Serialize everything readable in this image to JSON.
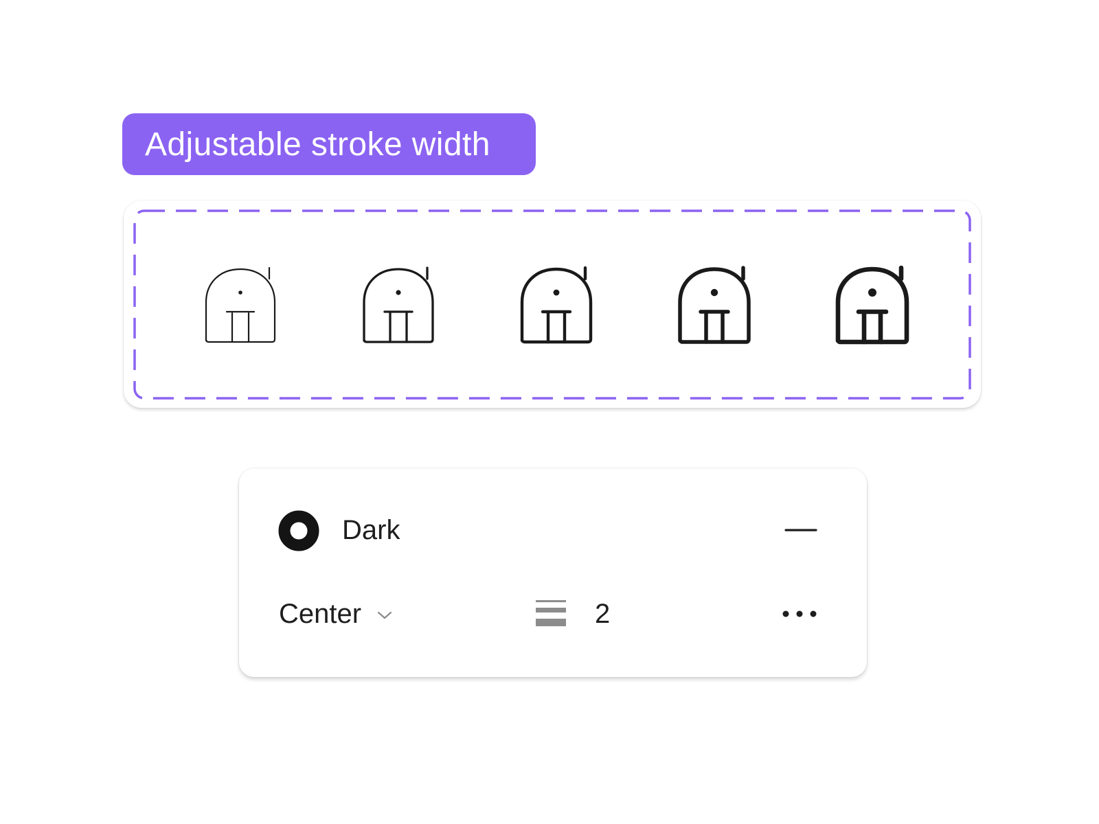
{
  "badge": {
    "label": "Adjustable stroke width",
    "color": "#8b63f2"
  },
  "showcase": {
    "frame_color": "#8b63f2",
    "icon_name": "android-icon",
    "icon_color": "#1a1a1a",
    "stroke_variants": [
      1,
      1.5,
      2,
      2.5,
      3
    ]
  },
  "panel": {
    "theme": {
      "icon": "donut-swatch-icon",
      "label": "Dark"
    },
    "remove_icon": "minus-icon",
    "alignment": {
      "label": "Center",
      "icon": "chevron-down-icon"
    },
    "stroke_weight": {
      "icon": "stroke-weight-icon",
      "value": "2"
    },
    "more_icon": "more-horizontal-icon"
  }
}
